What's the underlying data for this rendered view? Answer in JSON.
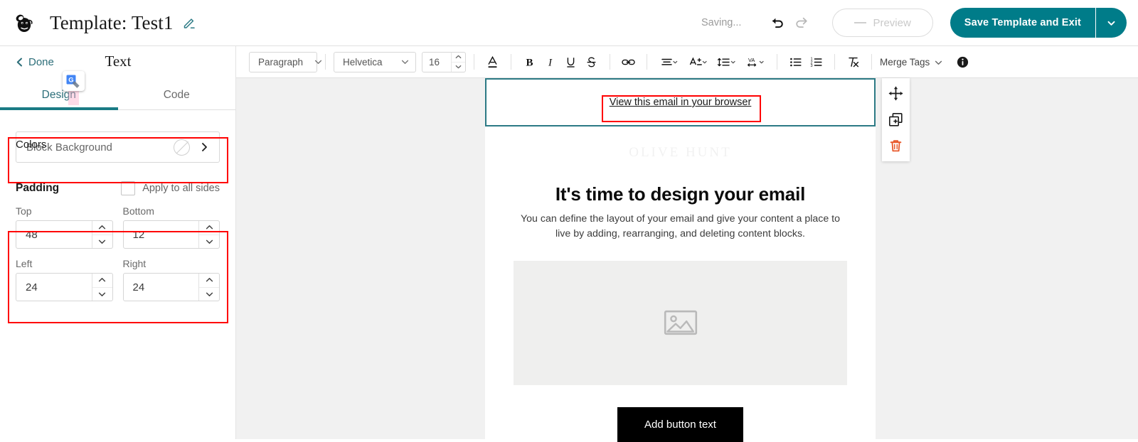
{
  "topbar": {
    "logo_icon": "mailchimp-freddie-logo",
    "title": "Template: Test1",
    "edit_icon": "pencil-icon",
    "saving_status": "Saving...",
    "undo_icon": "undo-arrow-icon",
    "redo_icon": "redo-arrow-icon",
    "preview_label": "Preview",
    "save_label": "Save Template and Exit",
    "save_caret_icon": "chevron-down-icon",
    "accent_color": "#007c89"
  },
  "sidebar": {
    "back_icon": "chevron-left-icon",
    "done_label": "Done",
    "panel_title": "Text",
    "tabs": [
      {
        "label": "Design",
        "active": true
      },
      {
        "label": "Code",
        "active": false
      }
    ],
    "translate_badge_icon": "google-translate-icon",
    "colors": {
      "section_label": "Colors",
      "row_label": "Block Background",
      "swatch_icon": "no-color-slash-icon",
      "chevron_icon": "chevron-right-icon"
    },
    "padding": {
      "section_label": "Padding",
      "apply_all_label": "Apply to all sides",
      "apply_all_checked": false,
      "fields": [
        {
          "label": "Top",
          "value": "48"
        },
        {
          "label": "Bottom",
          "value": "12"
        },
        {
          "label": "Left",
          "value": "24"
        },
        {
          "label": "Right",
          "value": "24"
        }
      ],
      "stepper_up_icon": "chevron-up-icon",
      "stepper_down_icon": "chevron-down-icon"
    }
  },
  "toolbar": {
    "block_style": "Paragraph",
    "font_family": "Helvetica",
    "font_size": "16",
    "text_color_icon": "text-color-a-icon",
    "bold_icon": "bold-icon",
    "italic_icon": "italic-icon",
    "underline_icon": "underline-icon",
    "strikethrough_icon": "strikethrough-icon",
    "link_icon": "link-icon",
    "align_icon": "text-align-icon",
    "letter_case_icon": "letter-spacing-icon",
    "line_height_icon": "line-height-icon",
    "kerning_icon": "kerning-icon",
    "bullet_list_icon": "bulleted-list-icon",
    "numbered_list_icon": "numbered-list-icon",
    "clear_format_icon": "clear-formatting-icon",
    "merge_tags_label": "Merge Tags",
    "info_icon": "info-icon"
  },
  "email": {
    "preheader_link": "View this email in your browser",
    "watermark_text": "OLIVE HUNT",
    "heading": "It's time to design your email",
    "paragraph": "You can define the layout of your email and give your content a place to live by adding, rearranging, and deleting content blocks.",
    "image_placeholder_icon": "image-placeholder-icon",
    "cta_label": "Add button text"
  },
  "block_actions": {
    "move_icon": "move-arrows-icon",
    "duplicate_icon": "duplicate-icon",
    "delete_icon": "trash-icon",
    "delete_color": "#e8582a"
  }
}
